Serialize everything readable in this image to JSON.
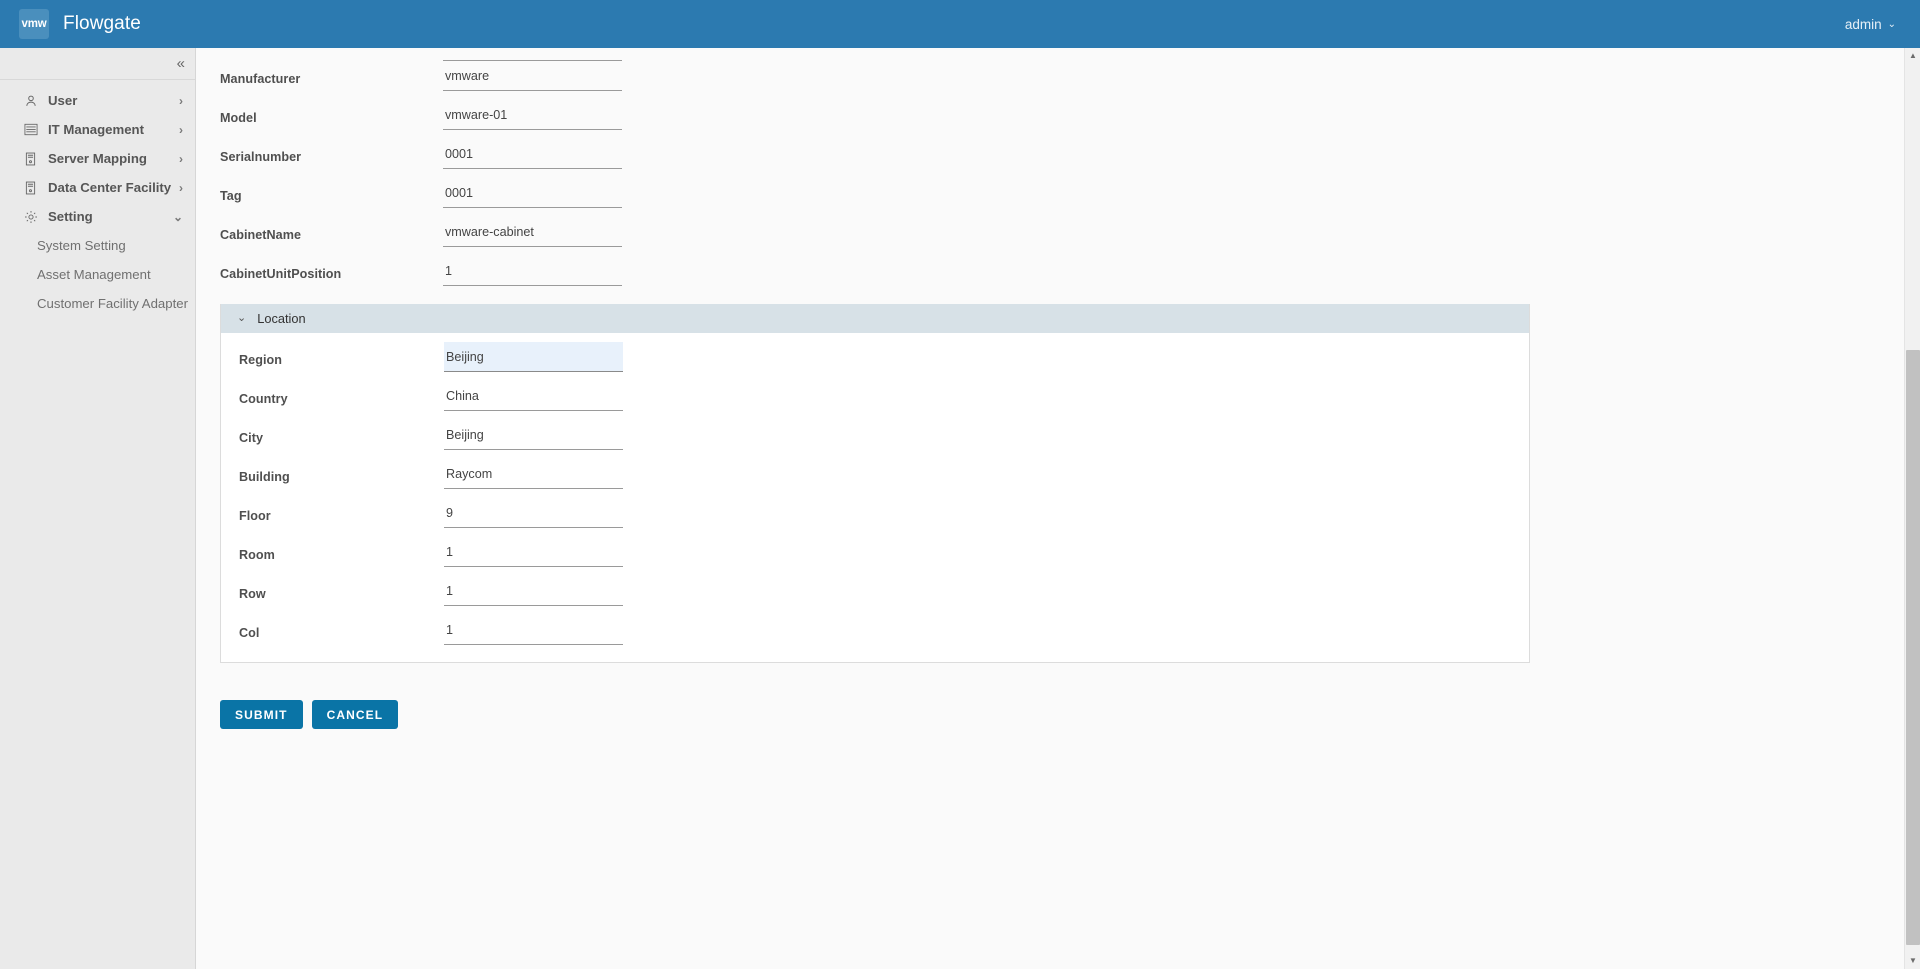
{
  "header": {
    "logo_text": "vmw",
    "title": "Flowgate",
    "user": "admin",
    "caret": "⌄",
    "bg_color": "#2c7ab0"
  },
  "sidebar": {
    "collapse_icon": "«",
    "items": [
      {
        "label": "User",
        "icon": "user-icon",
        "arrow": "›",
        "expanded": false
      },
      {
        "label": "IT Management",
        "icon": "list-icon",
        "arrow": "›",
        "expanded": false
      },
      {
        "label": "Server Mapping",
        "icon": "server-icon",
        "arrow": "›",
        "expanded": false
      },
      {
        "label": "Data Center Facility",
        "icon": "rack-icon",
        "arrow": "›",
        "expanded": false
      },
      {
        "label": "Setting",
        "icon": "gear-icon",
        "arrow": "⌄",
        "expanded": true
      }
    ],
    "sub_items": [
      {
        "label": "System Setting"
      },
      {
        "label": "Asset Management"
      },
      {
        "label": "Customer Facility Adapter"
      }
    ]
  },
  "form": {
    "fields": [
      {
        "label": "Manufacturer",
        "value": "vmware",
        "focused": false
      },
      {
        "label": "Model",
        "value": "vmware-01",
        "focused": false
      },
      {
        "label": "Serialnumber",
        "value": "0001",
        "focused": false
      },
      {
        "label": "Tag",
        "value": "0001",
        "focused": false
      },
      {
        "label": "CabinetName",
        "value": "vmware-cabinet",
        "focused": false
      },
      {
        "label": "CabinetUnitPosition",
        "value": "1",
        "focused": false
      }
    ]
  },
  "location_card": {
    "title": "Location",
    "chevron": "⌄",
    "header_color": "#d7e1e7",
    "fields": [
      {
        "label": "Region",
        "value": "Beijing",
        "focused": true
      },
      {
        "label": "Country",
        "value": "China",
        "focused": false
      },
      {
        "label": "City",
        "value": "Beijing",
        "focused": false
      },
      {
        "label": "Building",
        "value": "Raycom",
        "focused": false
      },
      {
        "label": "Floor",
        "value": "9",
        "focused": false
      },
      {
        "label": "Room",
        "value": "1",
        "focused": false
      },
      {
        "label": "Row",
        "value": "1",
        "focused": false
      },
      {
        "label": "Col",
        "value": "1",
        "focused": false
      }
    ]
  },
  "actions": {
    "submit_label": "SUBMIT",
    "cancel_label": "CANCEL",
    "button_color": "#0a74a6"
  },
  "scrollbar": {
    "up_arrow": "▲",
    "down_arrow": "▼"
  }
}
